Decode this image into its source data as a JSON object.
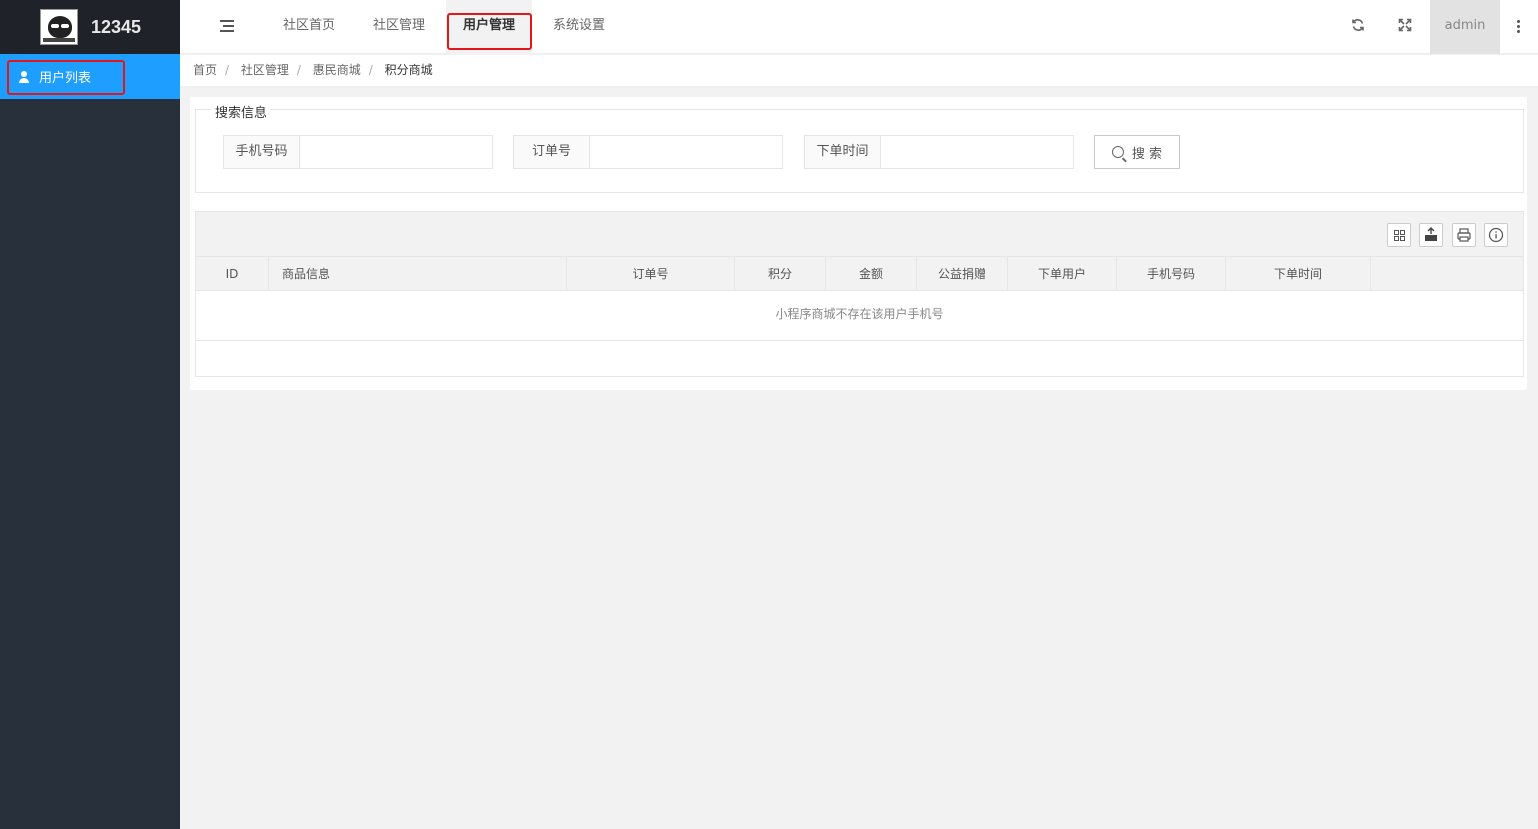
{
  "app": {
    "brand": "12345"
  },
  "sidebar": {
    "items": [
      {
        "label": "用户列表"
      }
    ]
  },
  "header": {
    "nav": [
      {
        "label": "社区首页"
      },
      {
        "label": "社区管理"
      },
      {
        "label": "用户管理"
      },
      {
        "label": "系统设置"
      }
    ],
    "active_nav": "用户管理",
    "user": "admin",
    "icons": [
      "menu-icon",
      "refresh-icon",
      "fullscreen-icon",
      "more-icon"
    ]
  },
  "breadcrumb": [
    "首页",
    "社区管理",
    "惠民商城",
    "积分商城"
  ],
  "search": {
    "legend": "搜索信息",
    "fields": [
      {
        "label": "手机号码",
        "value": ""
      },
      {
        "label": "订单号",
        "value": ""
      },
      {
        "label": "下单时间",
        "value": ""
      }
    ],
    "button_label": "搜 索"
  },
  "table": {
    "toolbar_icons": [
      "columns-icon",
      "export-icon",
      "print-icon",
      "info-icon"
    ],
    "columns": [
      "ID",
      "商品信息",
      "订单号",
      "积分",
      "金额",
      "公益捐赠",
      "下单用户",
      "手机号码",
      "下单时间"
    ],
    "empty_text": "小程序商城不存在该用户手机号"
  },
  "colors": {
    "accent": "#1e9fff",
    "sidebar": "#28313b",
    "highlight": "#e3161c"
  }
}
